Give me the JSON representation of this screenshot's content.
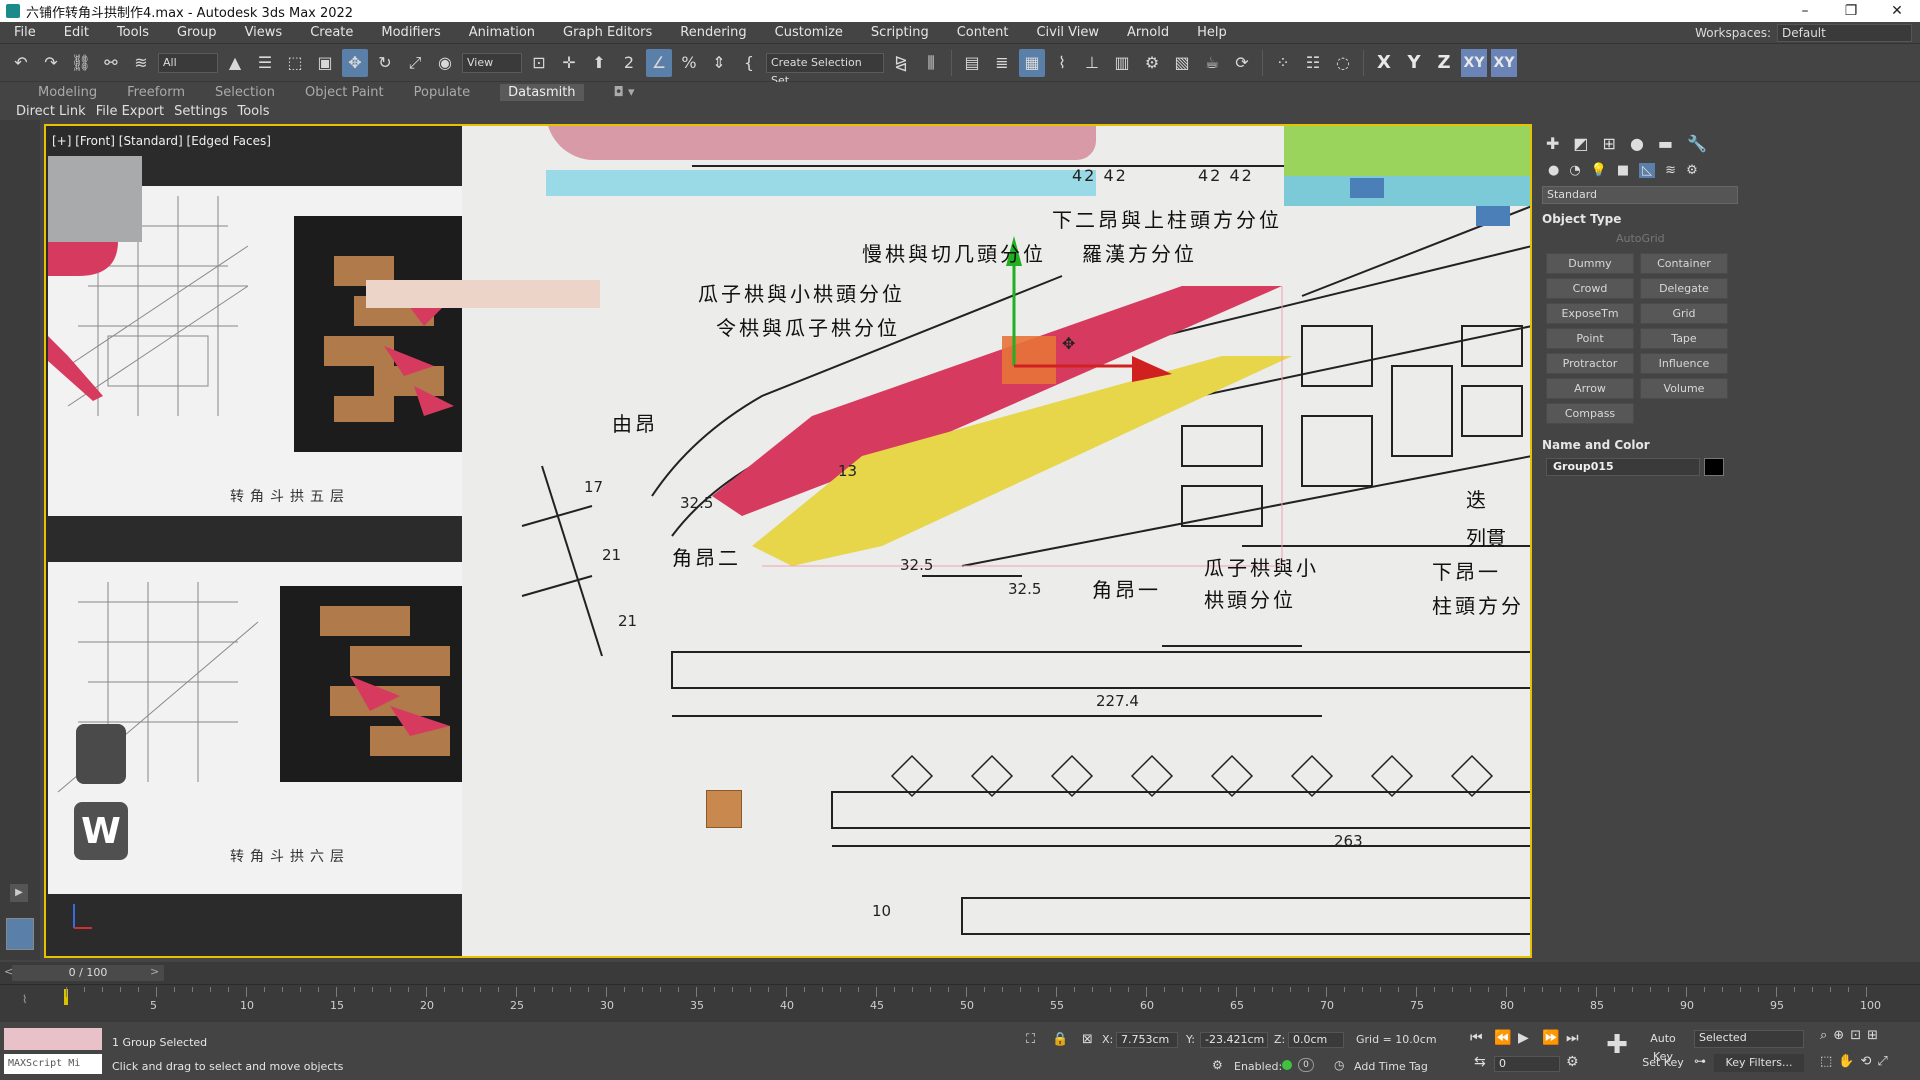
{
  "window": {
    "title": "六铺作转角斗拱制作4.max - Autodesk 3ds Max 2022",
    "controls": [
      "–",
      "❐",
      "✕"
    ]
  },
  "menubar": {
    "items": [
      "File",
      "Edit",
      "Tools",
      "Group",
      "Views",
      "Create",
      "Modifiers",
      "Animation",
      "Graph Editors",
      "Rendering",
      "Customize",
      "Scripting",
      "Content",
      "Civil View",
      "Arnold",
      "Help"
    ],
    "workspaces_label": "Workspaces:",
    "workspaces_value": "Default"
  },
  "toolbar": {
    "filter_value": "All",
    "view_value": "View",
    "selection_set_label": "Create Selection Set",
    "axis_x": "X",
    "axis_y": "Y",
    "axis_z": "Z",
    "axis_xy": "XY",
    "axis_xy2": "XY"
  },
  "ribbon": {
    "tabs": [
      "Modeling",
      "Freeform",
      "Selection",
      "Object Paint",
      "Populate",
      "Datasmith"
    ],
    "active_tab": "Datasmith"
  },
  "subbar": {
    "items": [
      "Direct Link",
      "File Export",
      "Settings",
      "Tools"
    ]
  },
  "viewport": {
    "label": "[+] [Front] [Standard] [Edged Faces]",
    "ref_caption_top": "转角斗拱五层",
    "ref_caption_bottom": "转角斗拱六层",
    "w_key": "W",
    "drawing_texts": {
      "t1": "下二昂與上柱頭方分位",
      "t2": "慢栱與切几頭分位",
      "t3": "羅漢方分位",
      "t4": "瓜子栱與小栱頭分位",
      "t5": "令栱與瓜子栱分位",
      "t6": "由昂",
      "t7": "角昂二",
      "t8": "角昂一",
      "t9": "瓜子栱與小",
      "t10": "栱頭分位",
      "t11": "下昂一",
      "t12": "柱頭方分",
      "t13": "列貫",
      "t14": "迭",
      "d1": "42 42",
      "d2": "42 42",
      "d3": "32.5",
      "d4": "32.5",
      "d5": "32.5",
      "d6": "13",
      "d7": "17",
      "d8": "21",
      "d9": "21",
      "d10": "227.4",
      "d11": "263",
      "d12": "10"
    }
  },
  "command_panel": {
    "category": "Standard",
    "object_type_header": "Object Type",
    "autogrid": "AutoGrid",
    "buttons": [
      "Dummy",
      "Container",
      "Crowd",
      "Delegate",
      "ExposeTm",
      "Grid",
      "Point",
      "Tape",
      "Protractor",
      "Influence",
      "Arrow",
      "Volume",
      "Compass"
    ],
    "name_color_header": "Name and Color",
    "object_name": "Group015",
    "object_color": "#000000"
  },
  "timeline": {
    "frame_display": "0 / 100",
    "ticks": [
      "5",
      "10",
      "15",
      "20",
      "25",
      "30",
      "35",
      "40",
      "45",
      "50",
      "55",
      "60",
      "65",
      "70",
      "75",
      "80",
      "85",
      "90",
      "95",
      "100"
    ]
  },
  "status": {
    "maxscript_label": "MAXScript Mi",
    "selection_status": "1 Group Selected",
    "prompt": "Click and drag to select and move objects",
    "x_label": "X:",
    "x_value": "7.753cm",
    "y_label": "Y:",
    "y_value": "-23.421cm",
    "z_label": "Z:",
    "z_value": "0.0cm",
    "grid": "Grid = 10.0cm",
    "enabled_label": "Enabled:",
    "add_time_tag": "Add Time Tag",
    "auto_key": "Auto Key",
    "selected_value": "Selected",
    "set_key": "Set Key",
    "key_filters": "Key Filters...",
    "frame_value": "0"
  },
  "colors": {
    "accent_blue": "#5a7fa8",
    "selection_yellow": "#e6c200",
    "crimson_face": "#d63a5e",
    "yellow_face": "#e7d54a",
    "pink_shape": "#d99aa8",
    "cyan_shape": "#9ad9e6"
  }
}
